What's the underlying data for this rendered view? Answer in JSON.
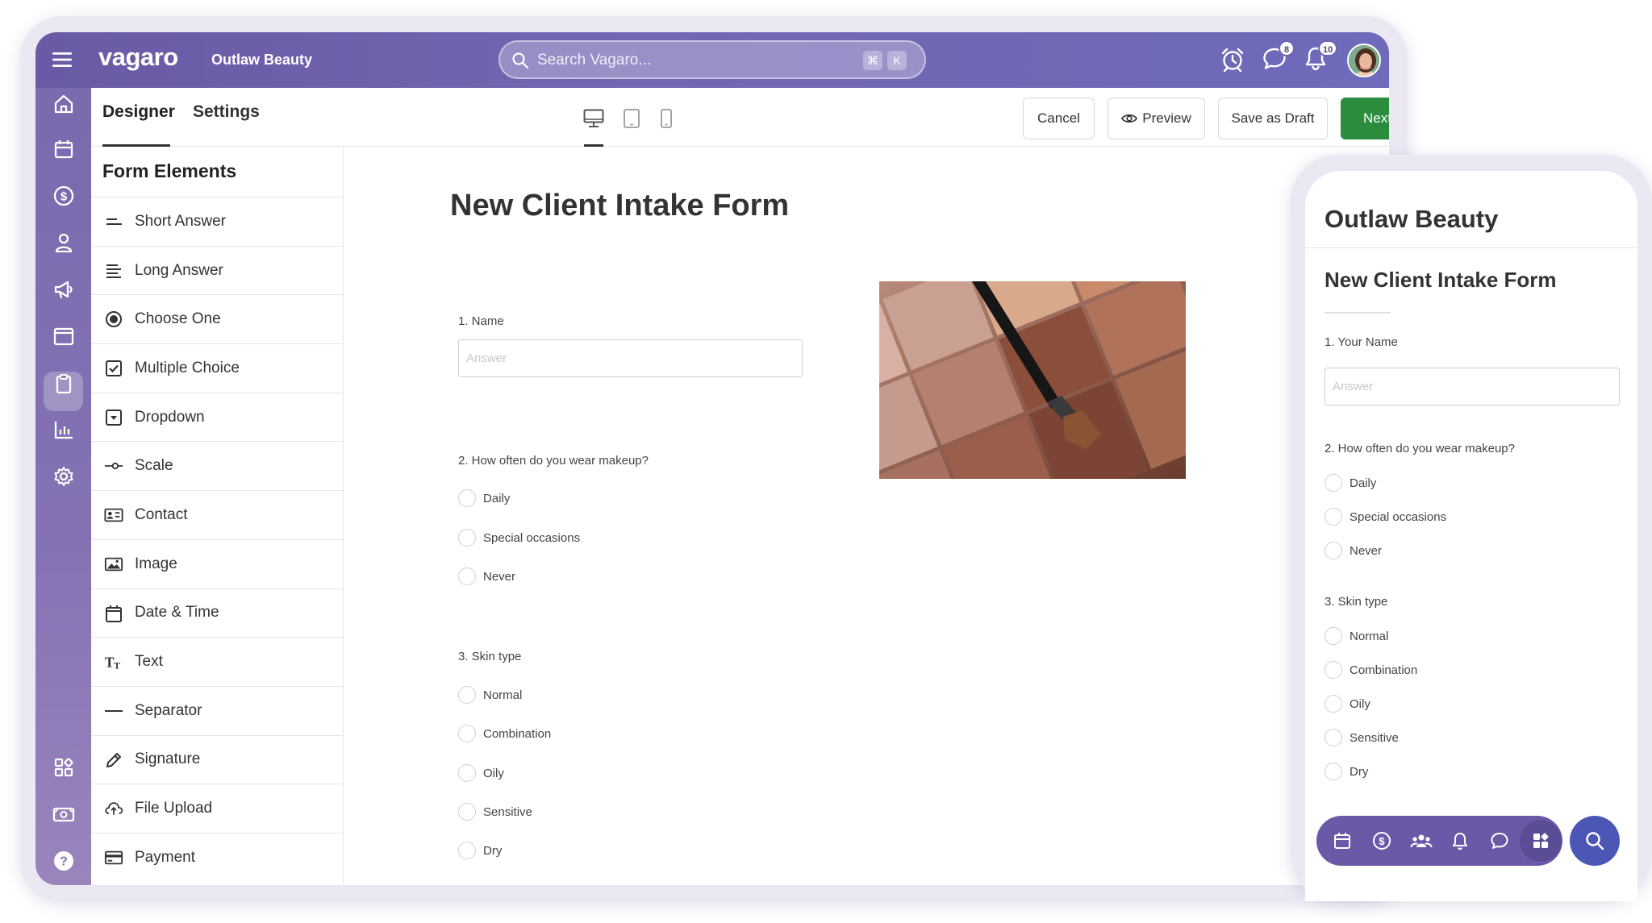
{
  "topbar": {
    "logo": "vagaro",
    "business": "Outlaw Beauty",
    "search_placeholder": "Search Vagaro...",
    "shortcut_cmd": "⌘",
    "shortcut_key": "K",
    "chat_badge": "8",
    "bell_badge": "10"
  },
  "nav": {
    "items": [
      "home",
      "calendar",
      "checkout",
      "clients",
      "marketing",
      "reports-window",
      "forms",
      "analytics",
      "settings",
      "apps",
      "cash-drawer",
      "help"
    ],
    "active": "forms"
  },
  "header": {
    "tab_designer": "Designer",
    "tab_settings": "Settings",
    "cancel": "Cancel",
    "preview": "Preview",
    "save_draft": "Save as Draft",
    "next": "Next"
  },
  "elements": {
    "title": "Form Elements",
    "items": [
      {
        "label": "Short Answer",
        "icon": "short-answer"
      },
      {
        "label": "Long Answer",
        "icon": "long-answer"
      },
      {
        "label": "Choose One",
        "icon": "radio"
      },
      {
        "label": "Multiple Choice",
        "icon": "checkbox"
      },
      {
        "label": "Dropdown",
        "icon": "dropdown"
      },
      {
        "label": "Scale",
        "icon": "scale"
      },
      {
        "label": "Contact",
        "icon": "contact-card"
      },
      {
        "label": "Image",
        "icon": "image"
      },
      {
        "label": "Date & Time",
        "icon": "calendar"
      },
      {
        "label": "Text",
        "icon": "text"
      },
      {
        "label": "Separator",
        "icon": "separator"
      },
      {
        "label": "Signature",
        "icon": "pen"
      },
      {
        "label": "File Upload",
        "icon": "cloud-upload"
      },
      {
        "label": "Payment",
        "icon": "credit-card"
      }
    ]
  },
  "form": {
    "title": "New Client Intake Form",
    "q1": {
      "label": "1. Name",
      "placeholder": "Answer"
    },
    "q2": {
      "label": "2. How often do you wear makeup?",
      "options": [
        "Daily",
        "Special occasions",
        "Never"
      ]
    },
    "q3": {
      "label": "3. Skin type",
      "options": [
        "Normal",
        "Combination",
        "Oily",
        "Sensitive",
        "Dry"
      ]
    }
  },
  "mobile": {
    "business": "Outlaw Beauty",
    "form_title": "New Client Intake Form",
    "q1": {
      "label": "1. Your Name",
      "placeholder": "Answer"
    },
    "q2": {
      "label": "2. How often do you wear makeup?",
      "options": [
        "Daily",
        "Special occasions",
        "Never"
      ]
    },
    "q3": {
      "label": "3. Skin type",
      "options": [
        "Normal",
        "Combination",
        "Oily",
        "Sensitive",
        "Dry"
      ]
    },
    "bottom_bar": [
      "calendar",
      "checkout",
      "clients",
      "notifications",
      "messages",
      "apps"
    ]
  },
  "colors": {
    "brand_purple": "#6d64b3",
    "next_green": "#2b8c3d",
    "mobile_search": "#4c56b5"
  }
}
